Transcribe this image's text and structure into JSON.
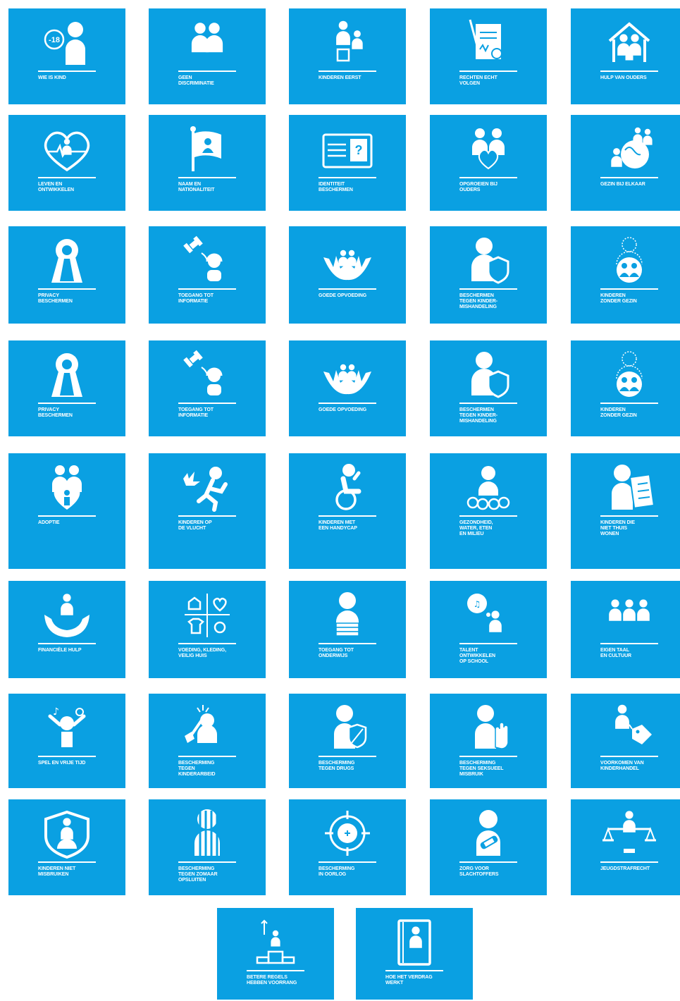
{
  "accent_color": "#0aa0e2",
  "tiles": [
    {
      "label": "WIE IS KIND",
      "icon": "child-minus-18-icon",
      "badge": "-18"
    },
    {
      "label": "GEEN\nDISCRIMINATIE",
      "icon": "two-children-icon"
    },
    {
      "label": "KINDEREN EERST",
      "icon": "adult-child-box-icon"
    },
    {
      "label": "RECHTEN ECHT\nVOLGEN",
      "icon": "signed-document-icon"
    },
    {
      "label": "HULP VAN OUDERS",
      "icon": "family-house-icon"
    },
    {
      "label": "LEVEN EN\nONTWIKKELEN",
      "icon": "heart-heartbeat-icon"
    },
    {
      "label": "NAAM EN\nNATIONALITEIT",
      "icon": "flag-person-icon"
    },
    {
      "label": "IDENTITEIT\nBESCHERMEN",
      "icon": "id-card-icon"
    },
    {
      "label": "OPGROEIEN BIJ\nOUDERS",
      "icon": "parents-broken-heart-icon"
    },
    {
      "label": "GEZIN BIJ ELKAAR",
      "icon": "family-globe-icon"
    },
    {
      "label": "PRIVACY\nBESCHERMEN",
      "icon": "keyhole-icon"
    },
    {
      "label": "TOEGANG TOT\nINFORMATIE",
      "icon": "satellite-child-icon"
    },
    {
      "label": "GOEDE OPVOEDING",
      "icon": "hands-family-icon"
    },
    {
      "label": "BESCHERMEN\nTEGEN KINDER-\nMISHANDELING",
      "icon": "child-shield-icon"
    },
    {
      "label": "KINDEREN\nZONDER GEZIN",
      "icon": "children-missing-parent-icon"
    },
    {
      "label": "PRIVACY\nBESCHERMEN",
      "icon": "keyhole-icon"
    },
    {
      "label": "TOEGANG TOT\nINFORMATIE",
      "icon": "satellite-child-icon"
    },
    {
      "label": "GOEDE OPVOEDING",
      "icon": "hands-family-icon"
    },
    {
      "label": "BESCHERMEN\nTEGEN KINDER-\nMISHANDELING",
      "icon": "child-shield-icon"
    },
    {
      "label": "KINDEREN\nZONDER GEZIN",
      "icon": "children-missing-parent-icon"
    },
    {
      "label": "ADOPTIE",
      "icon": "adoption-heart-icon"
    },
    {
      "label": "KINDEREN OP\nDE VLUCHT",
      "icon": "running-child-explosion-icon"
    },
    {
      "label": "KINDEREN MET\nEEN HANDYCAP",
      "icon": "wheelchair-icon"
    },
    {
      "label": "GEZONDHEID,\nWATER, ETEN\nEN MILIEU",
      "icon": "child-drops-icon"
    },
    {
      "label": "KINDEREN DIE\nNIET THUIS\nWONEN",
      "icon": "child-checklist-icon"
    },
    {
      "label": "FINANCIËLE HULP",
      "icon": "hands-child-icon"
    },
    {
      "label": "VOEDING, KLEDING,\nVEILIG HUIS",
      "icon": "house-heart-shirt-ring-icon"
    },
    {
      "label": "TOEGANG TOT\nONDERWIJS",
      "icon": "child-books-icon"
    },
    {
      "label": "TALENT\nONTWIKKELEN\nOP SCHOOL",
      "icon": "child-thought-bubble-icon"
    },
    {
      "label": "EIGEN TAAL\nEN CULTUUR",
      "icon": "three-people-icon"
    },
    {
      "label": "SPEL EN VRIJE TIJD",
      "icon": "child-music-ball-icon"
    },
    {
      "label": "BESCHERMING\nTEGEN\nKINDERARBEID",
      "icon": "child-shovel-icon"
    },
    {
      "label": "BESCHERMING\nTEGEN DRUGS",
      "icon": "child-crossed-shield-icon"
    },
    {
      "label": "BESCHERMING\nTEGEN SEKSUEEL\nMISBRUIK",
      "icon": "child-stop-hand-icon"
    },
    {
      "label": "VOORKOMEN VAN\nKINDERHANDEL",
      "icon": "child-price-tag-icon"
    },
    {
      "label": "KINDEREN NIET\nMISBRUIKEN",
      "icon": "shield-family-icon"
    },
    {
      "label": "BESCHERMING\nTEGEN ZOMAAR\nOPSLUITEN",
      "icon": "child-behind-bars-icon"
    },
    {
      "label": "BESCHERMING\nIN OORLOG",
      "icon": "crosshair-icon"
    },
    {
      "label": "ZORG VOOR\nSLACHTOFFERS",
      "icon": "child-bandage-icon"
    },
    {
      "label": "JEUGDSTRAFRECHT",
      "icon": "child-scales-icon"
    },
    {
      "label": "BETERE REGELS\nHEBBEN VOORRANG",
      "icon": "child-podium-icon"
    },
    {
      "label": "HOE HET VERDRAG\nWERKT",
      "icon": "child-book-icon"
    }
  ]
}
